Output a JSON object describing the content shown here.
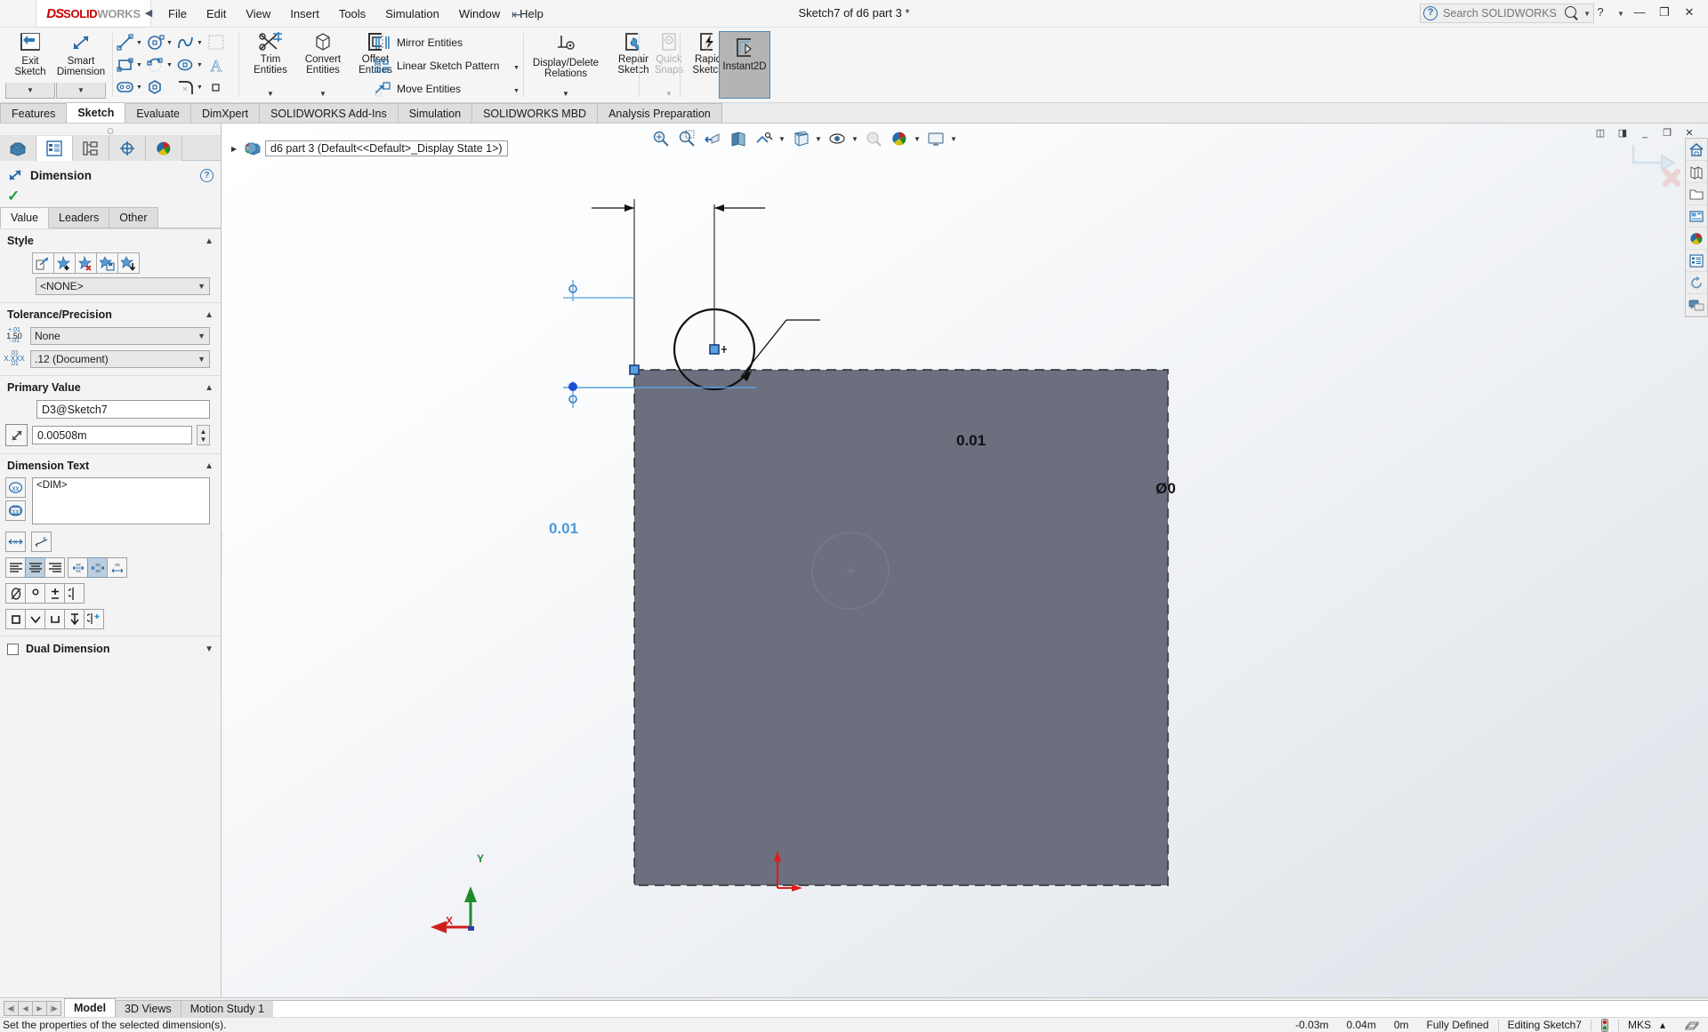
{
  "titlebar": {
    "logo_ds": "DS",
    "logo_solid": "SOLID",
    "logo_works": "WORKS",
    "menus": [
      "File",
      "Edit",
      "View",
      "Insert",
      "Tools",
      "Simulation",
      "Window",
      "Help"
    ],
    "doc_title": "Sketch7 of d6 part 3 *",
    "search_placeholder": "Search SOLIDWORKS Help",
    "help_label": "?",
    "minimize": "—",
    "restore": "❐",
    "close": "✕"
  },
  "ribbon": {
    "exit_sketch": {
      "line1": "Exit",
      "line2": "Sketch"
    },
    "smart_dimension": {
      "line1": "Smart",
      "line2": "Dimension"
    },
    "trim_entities": {
      "line1": "Trim",
      "line2": "Entities"
    },
    "convert_entities": {
      "line1": "Convert",
      "line2": "Entities"
    },
    "offset_entities": {
      "line1": "Offset",
      "line2": "Entities"
    },
    "mirror_entities": "Mirror Entities",
    "linear_sketch_pattern": "Linear Sketch Pattern",
    "move_entities": "Move Entities",
    "display_delete_relations": {
      "line1": "Display/Delete",
      "line2": "Relations"
    },
    "repair_sketch": {
      "line1": "Repair",
      "line2": "Sketch"
    },
    "quick_snaps": {
      "line1": "Quick",
      "line2": "Snaps"
    },
    "rapid_sketch": {
      "line1": "Rapid",
      "line2": "Sketch"
    },
    "instant2d": "Instant2D"
  },
  "command_tabs": [
    {
      "label": "Features",
      "active": false
    },
    {
      "label": "Sketch",
      "active": true
    },
    {
      "label": "Evaluate",
      "active": false
    },
    {
      "label": "DimXpert",
      "active": false
    },
    {
      "label": "SOLIDWORKS Add-Ins",
      "active": false
    },
    {
      "label": "Simulation",
      "active": false
    },
    {
      "label": "SOLIDWORKS MBD",
      "active": false
    },
    {
      "label": "Analysis Preparation",
      "active": false
    }
  ],
  "property_manager": {
    "tabs": [
      {
        "name": "feature-manager-tree-tab",
        "active": false
      },
      {
        "name": "property-manager-tab",
        "active": true
      },
      {
        "name": "configuration-manager-tab",
        "active": false
      },
      {
        "name": "dimxpert-manager-tab",
        "active": false
      },
      {
        "name": "display-manager-tab",
        "active": false
      }
    ],
    "title": "Dimension",
    "help_label": "?",
    "value_tabs": [
      {
        "label": "Value",
        "active": true
      },
      {
        "label": "Leaders",
        "active": false
      },
      {
        "label": "Other",
        "active": false
      }
    ],
    "style": {
      "heading": "Style",
      "combo_value": "<NONE>",
      "buttons": [
        "apply-style-icon",
        "add-style-icon",
        "delete-style-icon",
        "save-style-icon",
        "load-style-icon"
      ]
    },
    "tolerance_precision": {
      "heading": "Tolerance/Precision",
      "tolerance_type": "None",
      "tolerance_icon_top": "+.01",
      "tolerance_icon_mid": "1.50",
      "tolerance_icon_bot": "-.01",
      "precision": ".12 (Document)",
      "precision_icon_top": ".01",
      "precision_icon_mid": "X.XXX",
      "precision_icon_bot": ".01"
    },
    "primary_value": {
      "heading": "Primary Value",
      "name_value": "D3@Sketch7",
      "dim_value": "0.00508m"
    },
    "dimension_text": {
      "heading": "Dimension Text",
      "text": "<DIM>",
      "align_buttons": [
        "align-left-icon",
        "align-center-icon",
        "align-right-icon",
        "text-above-icon",
        "text-center-icon",
        "text-below-icon"
      ],
      "symbol_buttons": [
        "diameter-symbol-icon",
        "degree-symbol-icon",
        "plus-minus-symbol-icon",
        "centerline-symbol-icon"
      ],
      "symbol_buttons2": [
        "square-symbol-icon",
        "depth-symbol-icon",
        "counterbore-symbol-icon",
        "countersink-symbol-icon",
        "more-symbols-icon"
      ],
      "toggle_buttons": [
        "inspection-dim-icon",
        "arc-length-icon"
      ]
    },
    "dual_dimension": {
      "label": "Dual Dimension",
      "checked": false
    }
  },
  "feature_tree": {
    "root": "d6 part 3  (Default<<Default>_Display State 1>)"
  },
  "heads_up_toolbar": [
    "zoom-to-fit-icon",
    "zoom-to-area-icon",
    "previous-view-icon",
    "section-view-icon",
    "view-orientation-icon",
    "display-style-icon",
    "hide-show-items-icon",
    "edit-appearance-icon",
    "apply-scene-icon",
    "view-settings-icon"
  ],
  "right_toolbar": [
    "home-icon",
    "library-icon",
    "file-explorer-icon",
    "view-palette-icon",
    "appearances-icon",
    "custom-properties-icon",
    "reload-icon",
    "forum-icon"
  ],
  "sketch": {
    "horizontal_dimension": "0.01",
    "vertical_dimension": "0.01",
    "diameter_dimension": "Ø0",
    "origin_x_label": "X",
    "origin_y_label": "Y",
    "colors": {
      "face": "#6b6f7e",
      "dimension_selected": "#5aa0e0",
      "dimension_black": "#000000",
      "sketch_point_blue": "#1b4fd8",
      "origin_red": "#e01b1b",
      "origin_green": "#1f8a2a"
    }
  },
  "bottom": {
    "nav_buttons": [
      "first-icon",
      "prev-icon",
      "next-icon",
      "last-icon"
    ],
    "tabs": [
      {
        "label": "Model",
        "active": true
      },
      {
        "label": "3D Views",
        "active": false
      },
      {
        "label": "Motion Study 1",
        "active": false
      }
    ]
  },
  "status": {
    "message": "Set the properties of the selected dimension(s).",
    "coord_x": "-0.03m",
    "coord_y": "0.04m",
    "coord_z": "0m",
    "defined_state": "Fully Defined",
    "editing": "Editing Sketch7",
    "units": "MKS",
    "units_caret": "▴"
  }
}
